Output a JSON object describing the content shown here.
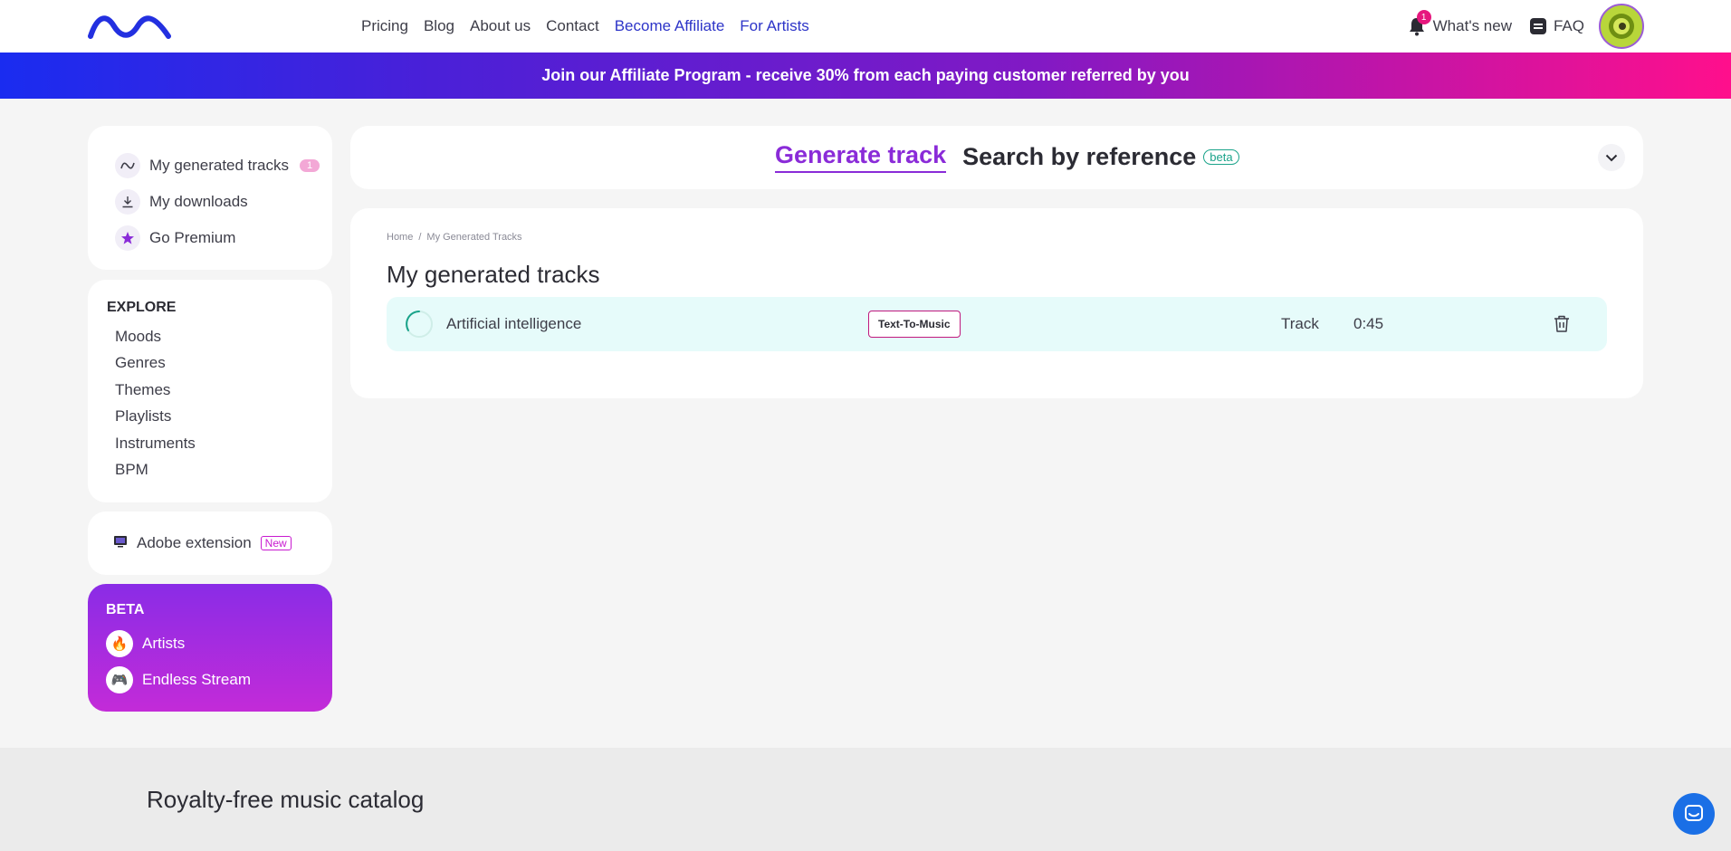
{
  "header": {
    "nav": [
      {
        "label": "Pricing"
      },
      {
        "label": "Blog"
      },
      {
        "label": "About us"
      },
      {
        "label": "Contact"
      },
      {
        "label": "Become Affiliate"
      },
      {
        "label": "For Artists"
      }
    ],
    "notifications_count": "1",
    "whats_new": "What's new",
    "faq": "FAQ"
  },
  "banner": "Join our Affiliate Program - receive 30% from each paying customer referred by you",
  "sidebar": {
    "library": [
      {
        "label": "My generated tracks",
        "icon": "waveform-icon",
        "badge": "1"
      },
      {
        "label": "My downloads",
        "icon": "download-icon"
      },
      {
        "label": "Go Premium",
        "icon": "star-icon"
      }
    ],
    "explore_title": "EXPLORE",
    "explore": [
      {
        "label": "Moods"
      },
      {
        "label": "Genres"
      },
      {
        "label": "Themes"
      },
      {
        "label": "Playlists"
      },
      {
        "label": "Instruments"
      },
      {
        "label": "BPM"
      }
    ],
    "adobe": {
      "label": "Adobe extension",
      "badge": "New"
    },
    "beta": {
      "title": "BETA",
      "items": [
        {
          "label": "Artists",
          "icon": "🔥"
        },
        {
          "label": "Endless Stream",
          "icon": "🎮"
        }
      ]
    }
  },
  "tabs": {
    "generate": "Generate track",
    "search": "Search by reference",
    "search_badge": "beta"
  },
  "main": {
    "breadcrumb": [
      "Home",
      "/",
      "My Generated Tracks"
    ],
    "title": "My generated tracks",
    "tracks": [
      {
        "name": "Artificial intelligence",
        "type": "Text-To-Music",
        "kind": "Track",
        "duration": "0:45"
      }
    ]
  },
  "footer": {
    "title": "Royalty-free music catalog"
  },
  "colors": {
    "accent": "#8a2bd8",
    "nav_accent": "#2d34c8",
    "row_bg": "#e6fbfa",
    "badge_pink": "#e6177e"
  }
}
